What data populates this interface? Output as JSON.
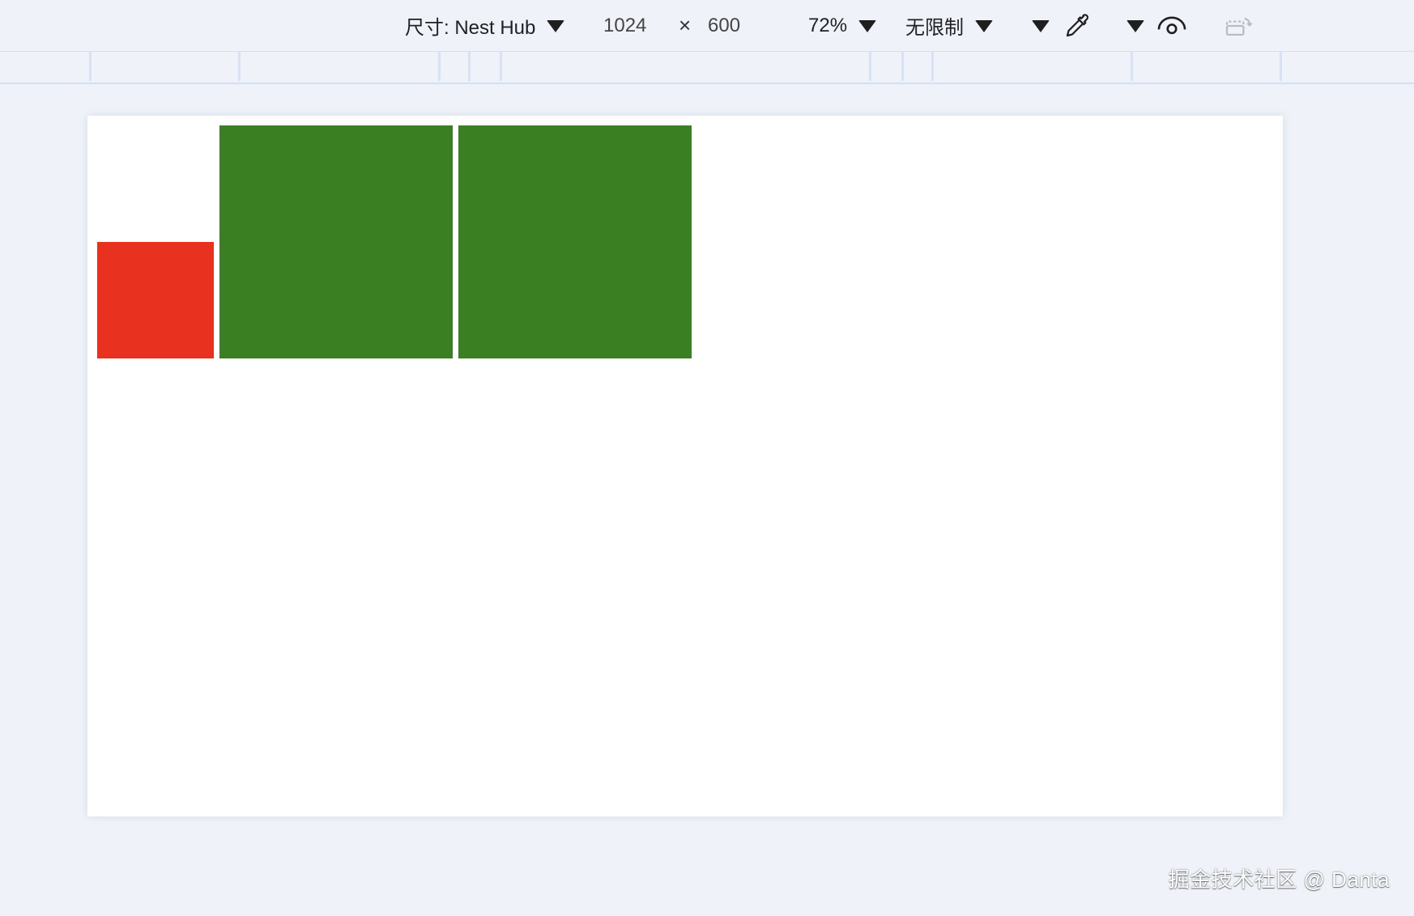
{
  "toolbar": {
    "device_label": "尺寸: Nest Hub",
    "width_value": "1024",
    "times_symbol": "×",
    "height_value": "600",
    "zoom_label": "72%",
    "throttle_label": "无限制",
    "icons": [
      "caret-down-icon",
      "eyedropper-icon",
      "eye-icon",
      "rotate-icon"
    ]
  },
  "colors": {
    "red_box": "#e8321f",
    "green_box": "#3a7f22",
    "viewport_bg": "#ffffff",
    "page_bg": "#eff3f9"
  },
  "boxes": [
    {
      "name": "red-box",
      "color": "#e8321f"
    },
    {
      "name": "green-box-1",
      "color": "#3a7f22"
    },
    {
      "name": "green-box-2",
      "color": "#3a7f22"
    }
  ],
  "watermark": "掘金技术社区 @ Danta"
}
